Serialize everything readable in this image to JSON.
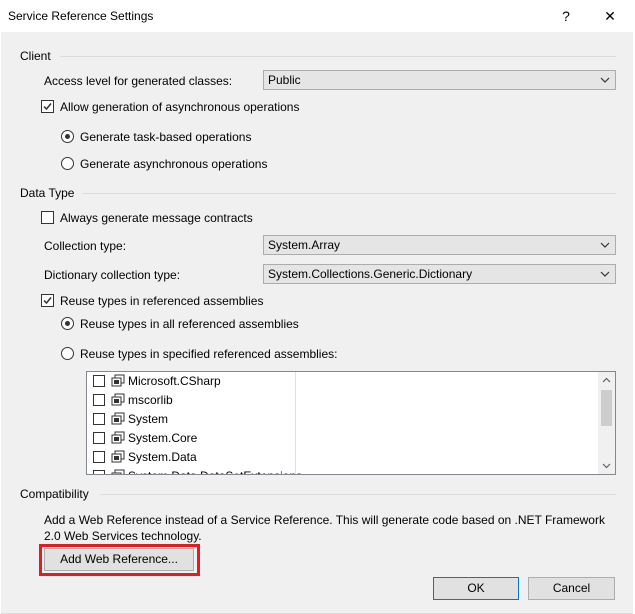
{
  "window": {
    "title": "Service Reference Settings",
    "help_glyph": "?",
    "close_glyph": "✕"
  },
  "client": {
    "section_label": "Client",
    "access_level_label": "Access level for generated classes:",
    "access_level_value": "Public",
    "allow_async_label": "Allow generation of asynchronous operations",
    "allow_async_checked": true,
    "task_based_label": "Generate task-based operations",
    "task_based_selected": true,
    "async_ops_label": "Generate asynchronous operations"
  },
  "data_type": {
    "section_label": "Data Type",
    "always_generate_label": "Always generate message contracts",
    "collection_type_label": "Collection type:",
    "collection_type_value": "System.Array",
    "dictionary_type_label": "Dictionary collection type:",
    "dictionary_type_value": "System.Collections.Generic.Dictionary",
    "reuse_types_label": "Reuse types in referenced assemblies",
    "reuse_types_checked": true,
    "reuse_all_label": "Reuse types in all referenced assemblies",
    "reuse_all_selected": true,
    "reuse_specified_label": "Reuse types in specified referenced assemblies:",
    "assemblies": [
      "Microsoft.CSharp",
      "mscorlib",
      "System",
      "System.Core",
      "System.Data",
      "System.Data.DataSetExtensions"
    ]
  },
  "compatibility": {
    "section_label": "Compatibility",
    "description": "Add a Web Reference instead of a Service Reference. This will generate code based on .NET Framework 2.0 Web Services technology.",
    "add_web_reference_label": "Add Web Reference..."
  },
  "footer": {
    "ok_label": "OK",
    "cancel_label": "Cancel"
  },
  "colors": {
    "highlight": "#e31b23",
    "dialog_background": "#f0f0f0",
    "default_button_border": "#0078d7"
  },
  "icons": {
    "dropdown": "chevron-down-icon",
    "assembly": "reference-icon"
  }
}
